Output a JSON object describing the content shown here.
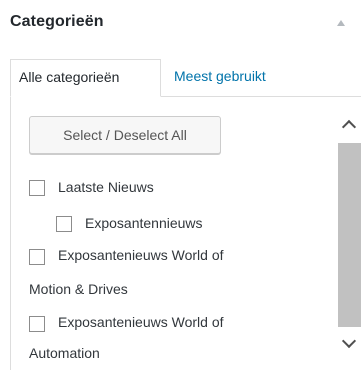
{
  "panel": {
    "title": "Categorieën",
    "collapse_icon": "triangle-up-icon"
  },
  "tabs": [
    {
      "label": "Alle categorieën",
      "active": true
    },
    {
      "label": "Meest gebruikt",
      "active": false
    }
  ],
  "colors": {
    "link": "#0073aa",
    "border": "#dddddd",
    "scroll_thumb": "#c1c1c1"
  },
  "list": {
    "select_all_label": "Select / Deselect All",
    "items": [
      {
        "label": "Laatste Nieuws",
        "checked": false
      },
      {
        "label": "Exposantennieuws",
        "checked": false
      },
      {
        "label": "Exposantenieuws World of",
        "label_cont": "Motion & Drives",
        "checked": false
      },
      {
        "label": "Exposantenieuws World of",
        "label_cont": "Automation",
        "checked": false
      }
    ]
  },
  "scrollbar": {
    "up_icon": "chevron-up-icon",
    "down_icon": "chevron-down-icon"
  }
}
